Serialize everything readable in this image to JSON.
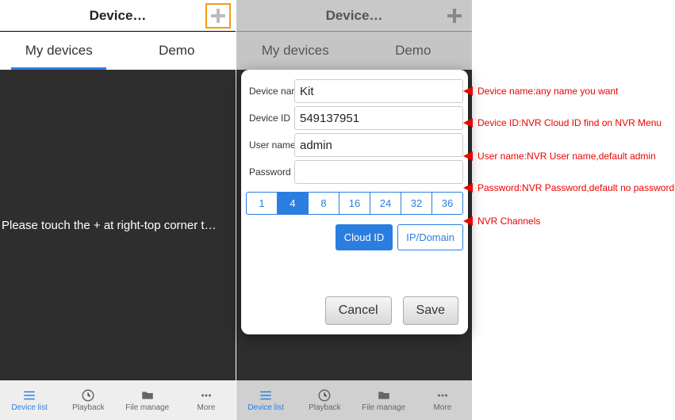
{
  "phone1": {
    "header": {
      "title": "Device…"
    },
    "tabs": {
      "my_devices": "My devices",
      "demo": "Demo"
    },
    "hint_text": "Please touch the + at right-top corner t…",
    "nav": {
      "device_list": "Device list",
      "playback": "Playback",
      "file_manage": "File manage",
      "more": "More"
    }
  },
  "phone2": {
    "header": {
      "title": "Device…"
    },
    "tabs": {
      "my_devices": "My devices",
      "demo": "Demo"
    },
    "nav": {
      "device_list": "Device list",
      "playback": "Playback",
      "file_manage": "File manage",
      "more": "More"
    }
  },
  "form": {
    "labels": {
      "device_name": "Device nam",
      "device_id": "Device ID",
      "user_name": "User name",
      "password": "Password"
    },
    "values": {
      "device_name": "Kit",
      "device_id": "549137951",
      "user_name": "admin",
      "password": ""
    },
    "channels": [
      "1",
      "4",
      "8",
      "16",
      "24",
      "32",
      "36"
    ],
    "channel_selected": "4",
    "modes": {
      "cloud": "Cloud ID",
      "ipdomain": "IP/Domain",
      "selected": "cloud"
    },
    "buttons": {
      "cancel": "Cancel",
      "save": "Save"
    }
  },
  "annotations": {
    "device_name": "Device name:any name you want",
    "device_id": "Device ID:NVR Cloud ID find on NVR Menu",
    "user_name": "User name:NVR User name,default admin",
    "password": "Password:NVR Password,default no password",
    "channels": "NVR Channels"
  }
}
